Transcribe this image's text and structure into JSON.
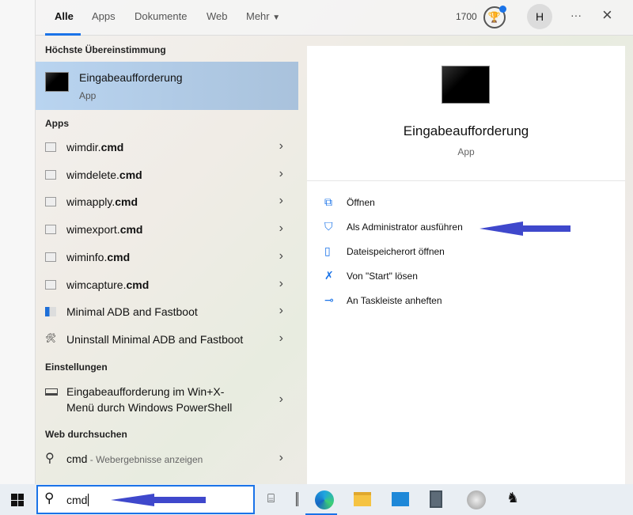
{
  "tabs": [
    {
      "label": "Alle",
      "active": true
    },
    {
      "label": "Apps"
    },
    {
      "label": "Dokumente"
    },
    {
      "label": "Web"
    },
    {
      "label": "Mehr"
    }
  ],
  "header_right": {
    "points": "1700",
    "avatar_letter": "H",
    "more": "···",
    "close": "×"
  },
  "sections": {
    "best_match": "Höchste Übereinstimmung",
    "apps": "Apps",
    "settings": "Einstellungen",
    "web": "Web durchsuchen"
  },
  "best_match": {
    "title": "Eingabeaufforderung",
    "subtitle": "App"
  },
  "apps": [
    {
      "label": "wimdir.cmd",
      "bold": "wimdir.",
      "rest": "cmd"
    },
    {
      "label": "wimdelete.cmd",
      "bold": "wimdelete.",
      "rest": "cmd"
    },
    {
      "label": "wimapply.cmd",
      "bold": "wimapply.",
      "rest": "cmd"
    },
    {
      "label": "wimexport.cmd",
      "bold": "wimexport.",
      "rest": "cmd"
    },
    {
      "label": "wiminfo.cmd",
      "bold": "wiminfo.",
      "rest": "cmd"
    },
    {
      "label": "wimcapture.cmd",
      "bold": "wimcapture.",
      "rest": "cmd"
    },
    {
      "label": "Minimal ADB and Fastboot"
    },
    {
      "label": "Uninstall Minimal ADB and Fastboot"
    }
  ],
  "settings_item": {
    "line1": "Eingabeaufforderung im Win+X-",
    "line2": "Menü durch Windows PowerShell"
  },
  "web_item": {
    "query": "cmd",
    "suffix": " - Webergebnisse anzeigen"
  },
  "detail": {
    "title": "Eingabeaufforderung",
    "subtitle": "App",
    "actions": [
      {
        "label": "Öffnen",
        "icon": "open-icon"
      },
      {
        "label": "Als Administrator ausführen",
        "icon": "shield-icon"
      },
      {
        "label": "Dateispeicherort öffnen",
        "icon": "folder-icon"
      },
      {
        "label": "Von \"Start\" lösen",
        "icon": "unpin-icon"
      },
      {
        "label": "An Taskleiste anheften",
        "icon": "pin-icon"
      }
    ]
  },
  "search": {
    "value": "cmd"
  },
  "colors": {
    "accent": "#1a73e8",
    "arrow": "#3f48cc",
    "selected": "#b9d4f0"
  }
}
